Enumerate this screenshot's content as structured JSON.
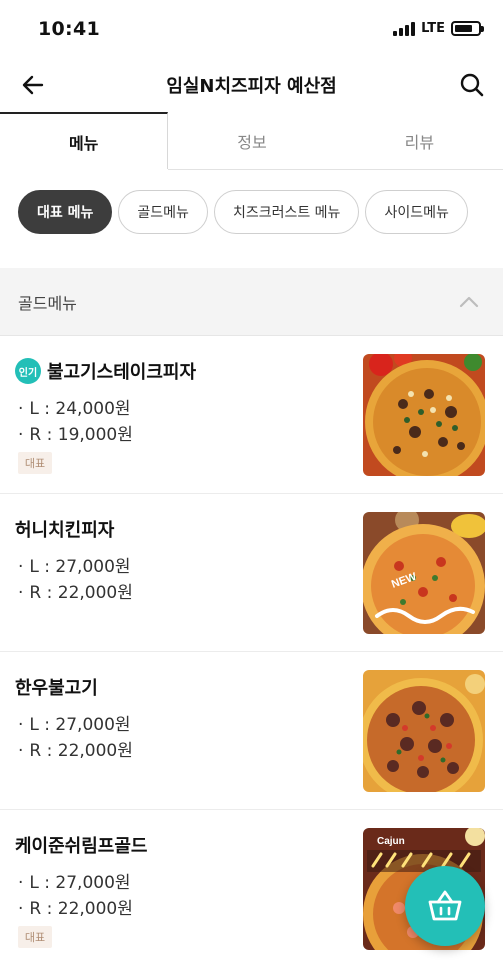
{
  "status_bar": {
    "time": "10:41",
    "network": "LTE",
    "battery_level": 0.75,
    "icons": [
      "signal-icon",
      "battery-icon"
    ]
  },
  "header": {
    "title": "임실N치즈피자 예산점",
    "back_icon": "back-arrow-icon",
    "search_icon": "search-icon"
  },
  "tabs": [
    {
      "label": "메뉴",
      "active": true
    },
    {
      "label": "정보",
      "active": false
    },
    {
      "label": "리뷰",
      "active": false
    }
  ],
  "chips": [
    {
      "label": "대표 메뉴",
      "active": true
    },
    {
      "label": "골드메뉴",
      "active": false
    },
    {
      "label": "치즈크러스트 메뉴",
      "active": false
    },
    {
      "label": "사이드메뉴",
      "active": false
    }
  ],
  "section": {
    "title": "골드메뉴",
    "collapse_icon": "chevron-up-icon"
  },
  "menu_items": [
    {
      "name": "불고기스테이크피자",
      "popular_badge": "인기",
      "prices": [
        "L : 24,000원",
        "R : 19,000원"
      ],
      "rep_badge": "대표"
    },
    {
      "name": "허니치킨피자",
      "prices": [
        "L : 27,000원",
        "R : 22,000원"
      ],
      "image_overlay_text": "NEW"
    },
    {
      "name": "한우불고기",
      "prices": [
        "L : 27,000원",
        "R : 22,000원"
      ]
    },
    {
      "name": "케이준쉬림프골드",
      "prices": [
        "L : 27,000원",
        "R : 22,000원"
      ],
      "rep_badge": "대표",
      "image_overlay_text": "Cajun"
    }
  ],
  "cart": {
    "icon": "shopping-basket-icon"
  },
  "colors": {
    "accent": "#23bfb7",
    "chip_active": "#3d3d3d"
  }
}
